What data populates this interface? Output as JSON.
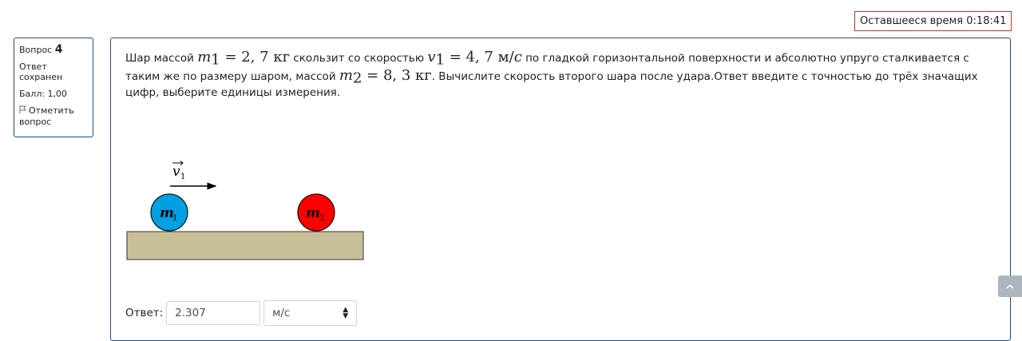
{
  "timer": {
    "label": "Оставшееся время",
    "value": "0:18:41"
  },
  "info": {
    "question_label": "Вопрос",
    "question_number": "4",
    "status": "Ответ сохранен",
    "score": "Балл: 1,00",
    "flag_label": "Отметить вопрос",
    "flag_icon": "flag-icon"
  },
  "question": {
    "t1": "Шар массой ",
    "m1_sym": "m",
    "m1_sub": "1",
    "m1_eq": " = 2, 7 ",
    "m1_unit": "кг",
    "t2": " скользит  со скоростью ",
    "v1_sym": "v",
    "v1_sub": "1",
    "v1_eq": " = 4, 7 ",
    "v1_unit_a": "м/",
    "v1_unit_b": "c",
    "t3": "  по гладкой горизонтальной поверхности и абсолютно упруго сталкивается  с таким же по размеру шаром, массой  ",
    "m2_sym": "m",
    "m2_sub": "2",
    "m2_eq": " = 8, 3 ",
    "m2_unit": "кг",
    "t4": ". Вычислите скорость второго шара после  удара.Ответ введите с точностью до трёх значащих цифр, выберите единицы измерения."
  },
  "figure": {
    "ball1_label": "m",
    "ball1_sub": "1",
    "ball2_label": "m",
    "ball2_sub": "2",
    "velocity_label": "v",
    "velocity_sub": "1",
    "ball1_color": "#00a0e3",
    "ball2_color": "#ff0000",
    "floor_color": "#c8bf99"
  },
  "answer": {
    "label": "Ответ:",
    "value": "2.307",
    "unit_selected": "м/с"
  },
  "scroll_top_icon": "chevron-up-icon"
}
